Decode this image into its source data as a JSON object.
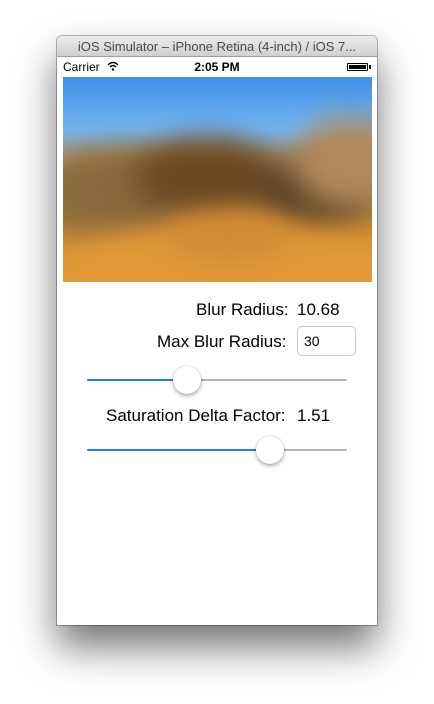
{
  "window": {
    "title": "iOS Simulator – iPhone Retina (4-inch) / iOS 7..."
  },
  "status_bar": {
    "carrier": "Carrier",
    "time": "2:05 PM"
  },
  "blur_radius": {
    "label": "Blur Radius:",
    "value": "10.68"
  },
  "max_blur_radius": {
    "label": "Max Blur Radius:",
    "value": "30"
  },
  "blur_slider": {
    "level": 0.37
  },
  "saturation": {
    "label": "Saturation Delta Factor:",
    "value": "1.51"
  },
  "saturation_slider": {
    "level": 0.73
  },
  "colors": {
    "accent": "#1a82fb",
    "track": "#b7b7b7"
  }
}
